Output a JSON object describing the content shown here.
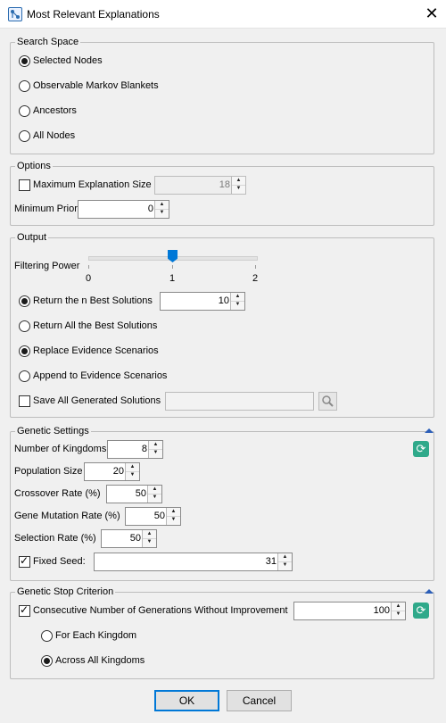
{
  "window": {
    "title": "Most Relevant Explanations",
    "close_glyph": "✕"
  },
  "search_space": {
    "title": "Search Space",
    "options": [
      "Selected Nodes",
      "Observable Markov Blankets",
      "Ancestors",
      "All Nodes"
    ],
    "selected": "Selected Nodes"
  },
  "options": {
    "title": "Options",
    "max_explanation_size_label": "Maximum Explanation Size",
    "max_explanation_size_checked": false,
    "max_explanation_size_value": "18",
    "minimum_prior_label": "Minimum Prior",
    "minimum_prior_value": "0"
  },
  "output": {
    "title": "Output",
    "filtering_power_label": "Filtering Power",
    "slider_ticks": [
      "0",
      "1",
      "2"
    ],
    "slider_value": 1,
    "return_n_best_label": "Return the n Best Solutions",
    "return_n_best_value": "10",
    "return_all_best_label": "Return All the Best Solutions",
    "replace_evidence_label": "Replace Evidence Scenarios",
    "append_evidence_label": "Append to Evidence Scenarios",
    "save_all_label": "Save All Generated Solutions",
    "save_all_checked": false,
    "save_path_value": ""
  },
  "genetic_settings": {
    "title": "Genetic Settings",
    "number_of_kingdoms_label": "Number of Kingdoms",
    "number_of_kingdoms_value": "8",
    "population_size_label": "Population Size",
    "population_size_value": "20",
    "crossover_rate_label": "Crossover Rate (%)",
    "crossover_rate_value": "50",
    "gene_mutation_rate_label": "Gene Mutation Rate (%)",
    "gene_mutation_rate_value": "50",
    "selection_rate_label": "Selection Rate (%)",
    "selection_rate_value": "50",
    "fixed_seed_label": "Fixed Seed:",
    "fixed_seed_checked": true,
    "fixed_seed_value": "31"
  },
  "genetic_stop": {
    "title": "Genetic Stop Criterion",
    "consecutive_label": "Consecutive Number of Generations Without Improvement",
    "consecutive_checked": true,
    "consecutive_value": "100",
    "for_each_kingdom_label": "For Each Kingdom",
    "across_all_kingdoms_label": "Across All Kingdoms",
    "selected": "Across All Kingdoms"
  },
  "buttons": {
    "ok_label": "OK",
    "cancel_label": "Cancel"
  },
  "colors": {
    "accent": "#0078d7",
    "refresh_icon": "#2fa98a",
    "collapse_arrow": "#2b5eb8"
  }
}
